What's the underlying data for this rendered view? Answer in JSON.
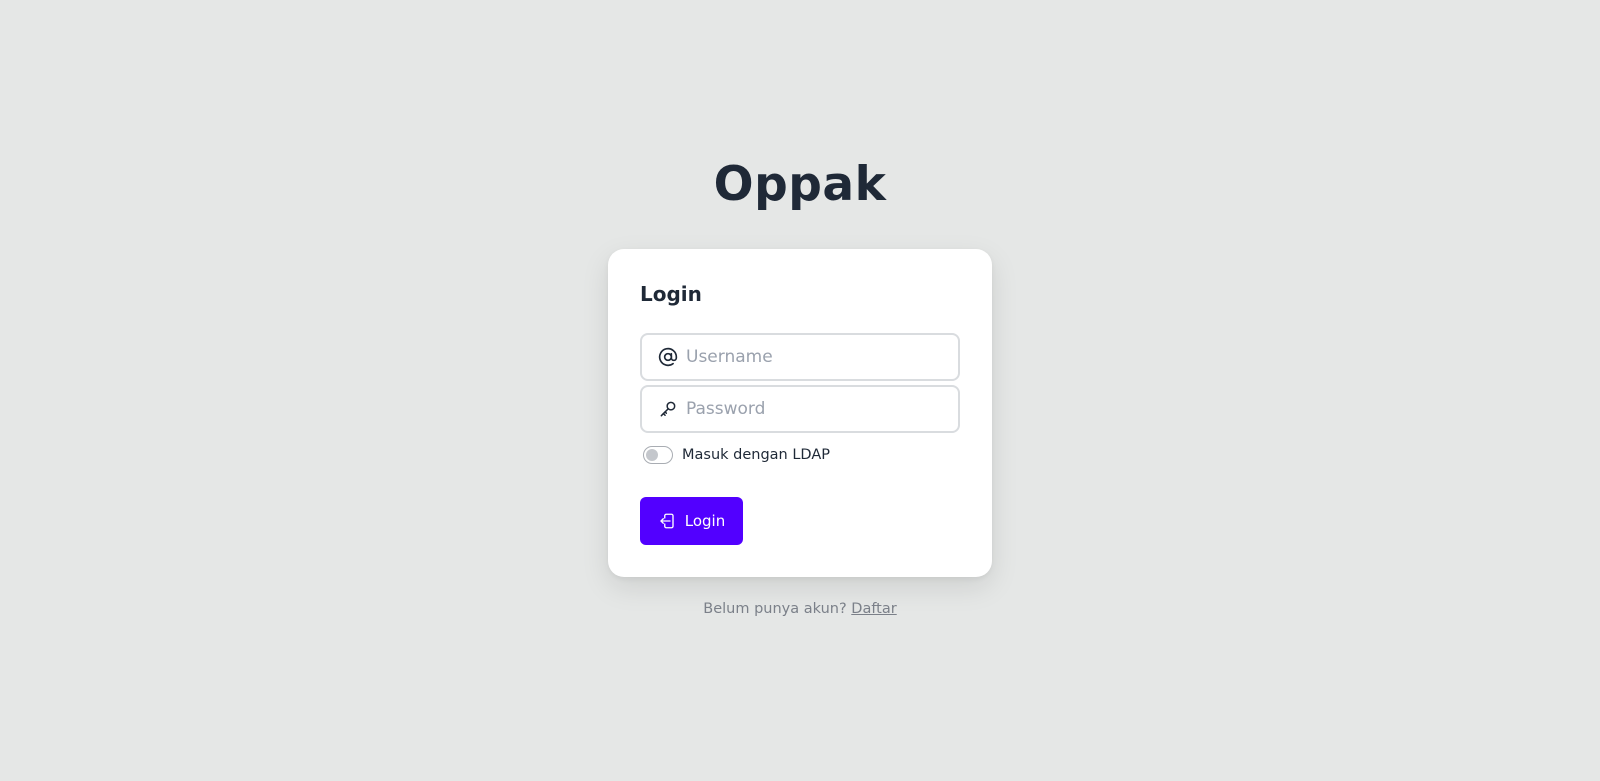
{
  "app": {
    "title": "Oppak"
  },
  "login_card": {
    "heading": "Login",
    "username": {
      "value": "",
      "placeholder": "Username",
      "icon": "at-sign-icon"
    },
    "password": {
      "value": "",
      "placeholder": "Password",
      "icon": "key-icon"
    },
    "ldap_toggle": {
      "label": "Masuk dengan LDAP",
      "checked": false
    },
    "submit": {
      "label": "Login",
      "icon": "login-icon"
    }
  },
  "footer": {
    "prompt": "Belum punya akun?",
    "register_link": "Daftar"
  },
  "colors": {
    "background": "#e5e7e6",
    "card": "#ffffff",
    "accent": "#5200ff",
    "text": "#1f2937",
    "muted": "#7b8089"
  }
}
